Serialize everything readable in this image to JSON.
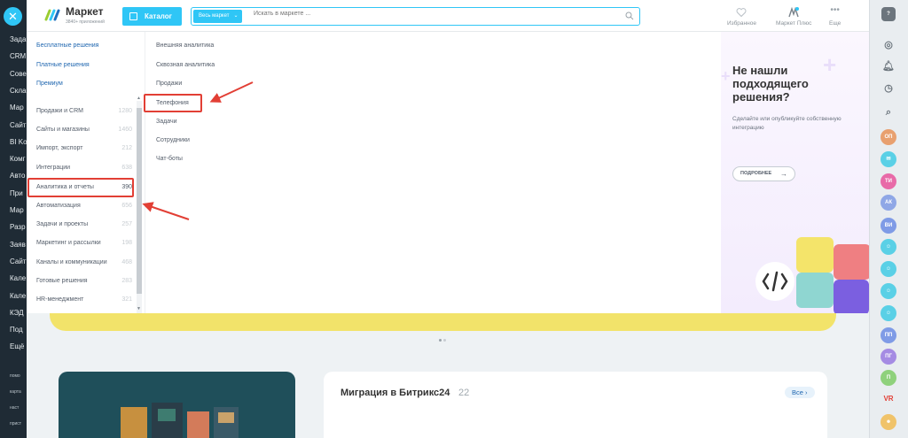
{
  "left_sidebar": {
    "items": [
      "Зада",
      "CRM",
      "Сове",
      "Скла",
      "Мар",
      "Сайт",
      "BI Ko",
      "Комг",
      "Авто",
      "При",
      "Мар",
      "Разр",
      "Заяв",
      "Сайт",
      "Кале",
      "Кале",
      "КЭД",
      "Под",
      "Ещё"
    ],
    "small_items": [
      "помо",
      "карта",
      "наст",
      "прист"
    ]
  },
  "header": {
    "brand_title": "Маркет",
    "brand_subtitle": "3840+ приложений",
    "catalog_label": "Каталог",
    "search_scope": "Весь маркет",
    "search_placeholder": "Искать в маркете ...",
    "favorites_label": "Избранное",
    "market_plus_label": "Маркет Плюс",
    "more_label": "Еще"
  },
  "menu": {
    "top_links": [
      "Бесплатные решения",
      "Платные решения",
      "Премиум"
    ],
    "categories": [
      {
        "label": "Продажи и CRM",
        "count": "1280"
      },
      {
        "label": "Сайты и магазины",
        "count": "1460"
      },
      {
        "label": "Импорт, экспорт",
        "count": "212"
      },
      {
        "label": "Интеграции",
        "count": "638"
      },
      {
        "label": "Аналитика и отчеты",
        "count": "390"
      },
      {
        "label": "Автоматизация",
        "count": "656"
      },
      {
        "label": "Задачи и проекты",
        "count": "257"
      },
      {
        "label": "Маркетинг и рассылки",
        "count": "198"
      },
      {
        "label": "Каналы и коммуникации",
        "count": "468"
      },
      {
        "label": "Готовые решения",
        "count": "283"
      },
      {
        "label": "HR-менеджмент",
        "count": "321"
      }
    ],
    "active_category": "Аналитика и отчеты",
    "subcategories": [
      "Внешняя аналитика",
      "Сквозная аналитика",
      "Продажи",
      "Телефония",
      "Задачи",
      "Сотрудники",
      "Чат-боты"
    ],
    "highlighted_subcategory": "Телефония"
  },
  "promo": {
    "title": "Не нашли подходящего решения?",
    "text": "Сделайте или опубликуйте собственную интеграцию",
    "button": "ПОДРОБНЕЕ"
  },
  "background": {
    "migration_title": "Миграция в Битрикс24",
    "migration_count": "22",
    "all_button": "Все"
  },
  "right_bar": {
    "avatars": [
      {
        "text": "ОП",
        "color": "#e8a06f"
      },
      {
        "text": "ТИ",
        "color": "#e86aa8"
      },
      {
        "text": "АК",
        "color": "#8fa7e6"
      },
      {
        "text": "ВИ",
        "color": "#7f9be6"
      },
      {
        "text": "ПП",
        "color": "#7f9be6"
      },
      {
        "text": "ПГ",
        "color": "#a58be3"
      },
      {
        "text": "П",
        "color": "#8fd17c"
      },
      {
        "text": "VR",
        "color": "#e23f35"
      }
    ]
  },
  "colors": {
    "accent": "#2fc6f6",
    "link": "#2067b0",
    "annotation": "#e23f35",
    "banner": "#f2e36a"
  }
}
